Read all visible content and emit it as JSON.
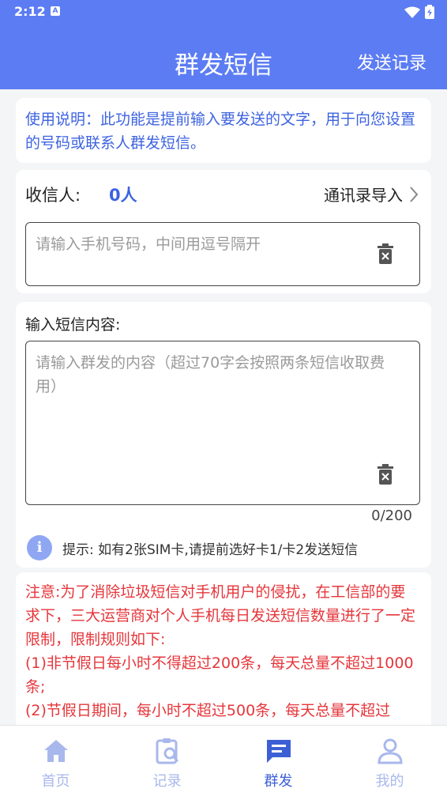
{
  "status_bar": {
    "time": "2:12",
    "notification_glyph": "A"
  },
  "header": {
    "title": "群发短信",
    "action_label": "发送记录"
  },
  "notice": {
    "text": "使用说明：此功能是提前输入要发送的文字，用于向您设置的号码或联系人群发短信。"
  },
  "recipient": {
    "label": "收信人:",
    "count": "0人",
    "import_label": "通讯录导入",
    "phone_placeholder": "请输入手机号码，中间用逗号隔开"
  },
  "content": {
    "label": "输入短信内容:",
    "placeholder": "请输入群发的内容（超过70字会按照两条短信收取费用）",
    "counter": "0/200",
    "tip": "提示: 如有2张SIM卡,请提前选好卡1/卡2发送短信"
  },
  "warning": {
    "lines": "注意:为了消除垃圾短信对手机用户的侵扰，在工信部的要求下，三大运营商对个人手机每日发送短信数量进行了一定限制，限制规则如下:\n(1)非节假日每小时不得超过200条，每天总量不超过1000条;\n(2)节假日期间，每小时不超过500条，每天总量不超过"
  },
  "tabs": [
    {
      "label": "首页",
      "icon": "home-icon",
      "active": false
    },
    {
      "label": "记录",
      "icon": "clipboard-search-icon",
      "active": false
    },
    {
      "label": "群发",
      "icon": "message-icon",
      "active": true
    },
    {
      "label": "我的",
      "icon": "user-icon",
      "active": false
    }
  ],
  "colors": {
    "primary": "#5c7cf3",
    "accent_text": "#3d63e0",
    "warning": "#e5363b",
    "tab_inactive": "#a9b8ec"
  }
}
